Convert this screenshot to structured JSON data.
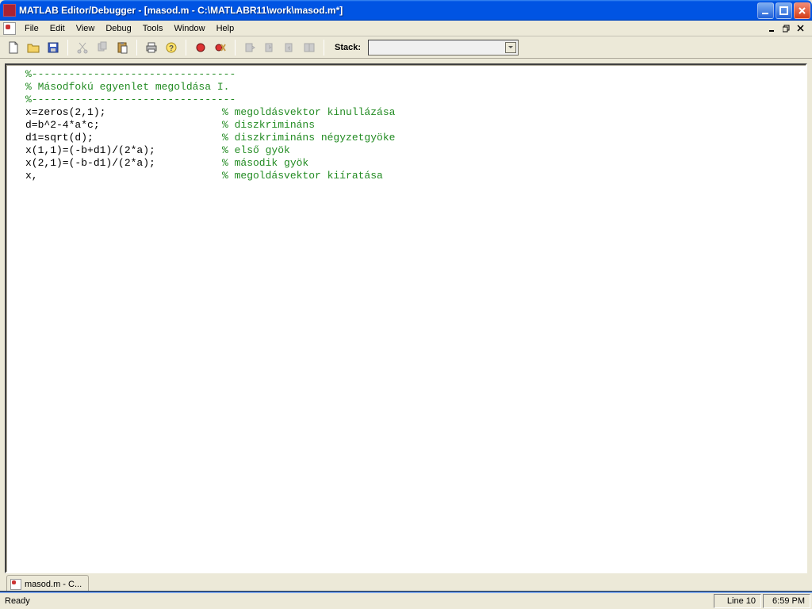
{
  "title": "MATLAB Editor/Debugger - [masod.m - C:\\MATLABR11\\work\\masod.m*]",
  "menu": {
    "file": "File",
    "edit": "Edit",
    "view": "View",
    "debug": "Debug",
    "tools": "Tools",
    "window": "Window",
    "help": "Help"
  },
  "toolbar": {
    "stack_label": "Stack:",
    "stack_value": ""
  },
  "code": {
    "l1": "%---------------------------------",
    "l2": "% Másodfokú egyenlet megoldása I.",
    "l3": "%---------------------------------",
    "l4_code": "x=zeros(2,1);",
    "l4_c": "% megoldásvektor kinullázása",
    "l5_code": "d=b^2-4*a*c;",
    "l5_c": "% diszkrimináns",
    "l6_code": "d1=sqrt(d);",
    "l6_c": "% diszkrimináns négyzetgyöke",
    "l7_code": "x(1,1)=(-b+d1)/(2*a);",
    "l7_c": "% első gyök",
    "l8_code": "x(2,1)=(-b-d1)/(2*a);",
    "l8_c": "% második gyök",
    "l9_code": "x,",
    "l9_c": "% megoldásvektor kiíratása"
  },
  "tab": {
    "label": "masod.m - C..."
  },
  "status": {
    "ready": "Ready",
    "line": "Line 10",
    "time": "6:59 PM"
  }
}
